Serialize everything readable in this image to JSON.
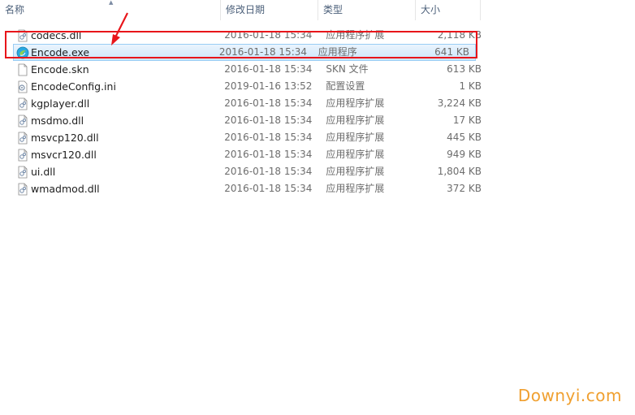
{
  "columns": {
    "name": "名称",
    "date": "修改日期",
    "type": "类型",
    "size": "大小"
  },
  "files": [
    {
      "name": "codecs.dll",
      "date": "2016-01-18 15:34",
      "type": "应用程序扩展",
      "size": "2,118 KB",
      "icon": "dll-icon"
    },
    {
      "name": "Encode.exe",
      "date": "2016-01-18 15:34",
      "type": "应用程序",
      "size": "641 KB",
      "icon": "exe-icon",
      "selected": true
    },
    {
      "name": "Encode.skn",
      "date": "2016-01-18 15:34",
      "type": "SKN 文件",
      "size": "613 KB",
      "icon": "blank-file-icon"
    },
    {
      "name": "EncodeConfig.ini",
      "date": "2019-01-16 13:52",
      "type": "配置设置",
      "size": "1 KB",
      "icon": "ini-icon"
    },
    {
      "name": "kgplayer.dll",
      "date": "2016-01-18 15:34",
      "type": "应用程序扩展",
      "size": "3,224 KB",
      "icon": "dll-icon"
    },
    {
      "name": "msdmo.dll",
      "date": "2016-01-18 15:34",
      "type": "应用程序扩展",
      "size": "17 KB",
      "icon": "dll-icon"
    },
    {
      "name": "msvcp120.dll",
      "date": "2016-01-18 15:34",
      "type": "应用程序扩展",
      "size": "445 KB",
      "icon": "dll-icon"
    },
    {
      "name": "msvcr120.dll",
      "date": "2016-01-18 15:34",
      "type": "应用程序扩展",
      "size": "949 KB",
      "icon": "dll-icon"
    },
    {
      "name": "ui.dll",
      "date": "2016-01-18 15:34",
      "type": "应用程序扩展",
      "size": "1,804 KB",
      "icon": "dll-icon"
    },
    {
      "name": "wmadmod.dll",
      "date": "2016-01-18 15:34",
      "type": "应用程序扩展",
      "size": "372 KB",
      "icon": "dll-icon"
    }
  ],
  "watermark": "Downyi.com",
  "colors": {
    "highlight": "#e8151a",
    "selection": "#cde6fb",
    "watermark": "#f0a030"
  }
}
